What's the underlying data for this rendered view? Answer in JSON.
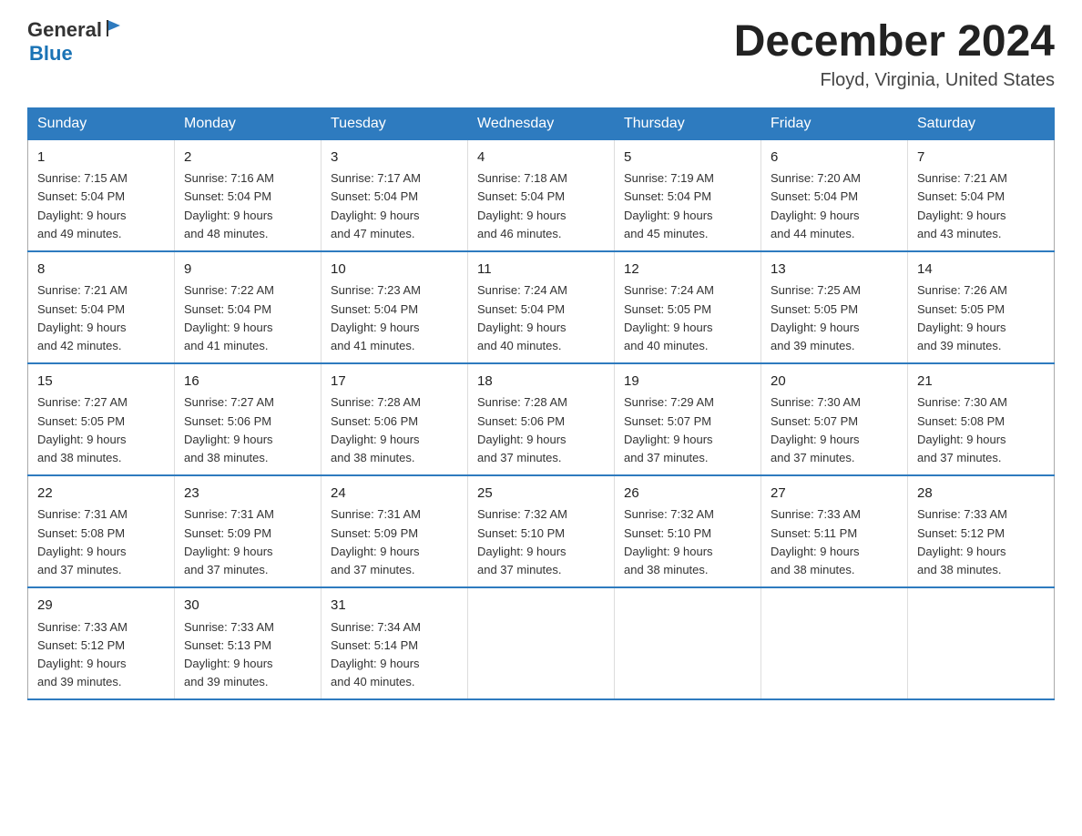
{
  "logo": {
    "general": "General",
    "blue": "Blue"
  },
  "title": "December 2024",
  "location": "Floyd, Virginia, United States",
  "days_of_week": [
    "Sunday",
    "Monday",
    "Tuesday",
    "Wednesday",
    "Thursday",
    "Friday",
    "Saturday"
  ],
  "weeks": [
    [
      {
        "day": "1",
        "sunrise": "7:15 AM",
        "sunset": "5:04 PM",
        "daylight": "9 hours and 49 minutes."
      },
      {
        "day": "2",
        "sunrise": "7:16 AM",
        "sunset": "5:04 PM",
        "daylight": "9 hours and 48 minutes."
      },
      {
        "day": "3",
        "sunrise": "7:17 AM",
        "sunset": "5:04 PM",
        "daylight": "9 hours and 47 minutes."
      },
      {
        "day": "4",
        "sunrise": "7:18 AM",
        "sunset": "5:04 PM",
        "daylight": "9 hours and 46 minutes."
      },
      {
        "day": "5",
        "sunrise": "7:19 AM",
        "sunset": "5:04 PM",
        "daylight": "9 hours and 45 minutes."
      },
      {
        "day": "6",
        "sunrise": "7:20 AM",
        "sunset": "5:04 PM",
        "daylight": "9 hours and 44 minutes."
      },
      {
        "day": "7",
        "sunrise": "7:21 AM",
        "sunset": "5:04 PM",
        "daylight": "9 hours and 43 minutes."
      }
    ],
    [
      {
        "day": "8",
        "sunrise": "7:21 AM",
        "sunset": "5:04 PM",
        "daylight": "9 hours and 42 minutes."
      },
      {
        "day": "9",
        "sunrise": "7:22 AM",
        "sunset": "5:04 PM",
        "daylight": "9 hours and 41 minutes."
      },
      {
        "day": "10",
        "sunrise": "7:23 AM",
        "sunset": "5:04 PM",
        "daylight": "9 hours and 41 minutes."
      },
      {
        "day": "11",
        "sunrise": "7:24 AM",
        "sunset": "5:04 PM",
        "daylight": "9 hours and 40 minutes."
      },
      {
        "day": "12",
        "sunrise": "7:24 AM",
        "sunset": "5:05 PM",
        "daylight": "9 hours and 40 minutes."
      },
      {
        "day": "13",
        "sunrise": "7:25 AM",
        "sunset": "5:05 PM",
        "daylight": "9 hours and 39 minutes."
      },
      {
        "day": "14",
        "sunrise": "7:26 AM",
        "sunset": "5:05 PM",
        "daylight": "9 hours and 39 minutes."
      }
    ],
    [
      {
        "day": "15",
        "sunrise": "7:27 AM",
        "sunset": "5:05 PM",
        "daylight": "9 hours and 38 minutes."
      },
      {
        "day": "16",
        "sunrise": "7:27 AM",
        "sunset": "5:06 PM",
        "daylight": "9 hours and 38 minutes."
      },
      {
        "day": "17",
        "sunrise": "7:28 AM",
        "sunset": "5:06 PM",
        "daylight": "9 hours and 38 minutes."
      },
      {
        "day": "18",
        "sunrise": "7:28 AM",
        "sunset": "5:06 PM",
        "daylight": "9 hours and 37 minutes."
      },
      {
        "day": "19",
        "sunrise": "7:29 AM",
        "sunset": "5:07 PM",
        "daylight": "9 hours and 37 minutes."
      },
      {
        "day": "20",
        "sunrise": "7:30 AM",
        "sunset": "5:07 PM",
        "daylight": "9 hours and 37 minutes."
      },
      {
        "day": "21",
        "sunrise": "7:30 AM",
        "sunset": "5:08 PM",
        "daylight": "9 hours and 37 minutes."
      }
    ],
    [
      {
        "day": "22",
        "sunrise": "7:31 AM",
        "sunset": "5:08 PM",
        "daylight": "9 hours and 37 minutes."
      },
      {
        "day": "23",
        "sunrise": "7:31 AM",
        "sunset": "5:09 PM",
        "daylight": "9 hours and 37 minutes."
      },
      {
        "day": "24",
        "sunrise": "7:31 AM",
        "sunset": "5:09 PM",
        "daylight": "9 hours and 37 minutes."
      },
      {
        "day": "25",
        "sunrise": "7:32 AM",
        "sunset": "5:10 PM",
        "daylight": "9 hours and 37 minutes."
      },
      {
        "day": "26",
        "sunrise": "7:32 AM",
        "sunset": "5:10 PM",
        "daylight": "9 hours and 38 minutes."
      },
      {
        "day": "27",
        "sunrise": "7:33 AM",
        "sunset": "5:11 PM",
        "daylight": "9 hours and 38 minutes."
      },
      {
        "day": "28",
        "sunrise": "7:33 AM",
        "sunset": "5:12 PM",
        "daylight": "9 hours and 38 minutes."
      }
    ],
    [
      {
        "day": "29",
        "sunrise": "7:33 AM",
        "sunset": "5:12 PM",
        "daylight": "9 hours and 39 minutes."
      },
      {
        "day": "30",
        "sunrise": "7:33 AM",
        "sunset": "5:13 PM",
        "daylight": "9 hours and 39 minutes."
      },
      {
        "day": "31",
        "sunrise": "7:34 AM",
        "sunset": "5:14 PM",
        "daylight": "9 hours and 40 minutes."
      },
      null,
      null,
      null,
      null
    ]
  ]
}
